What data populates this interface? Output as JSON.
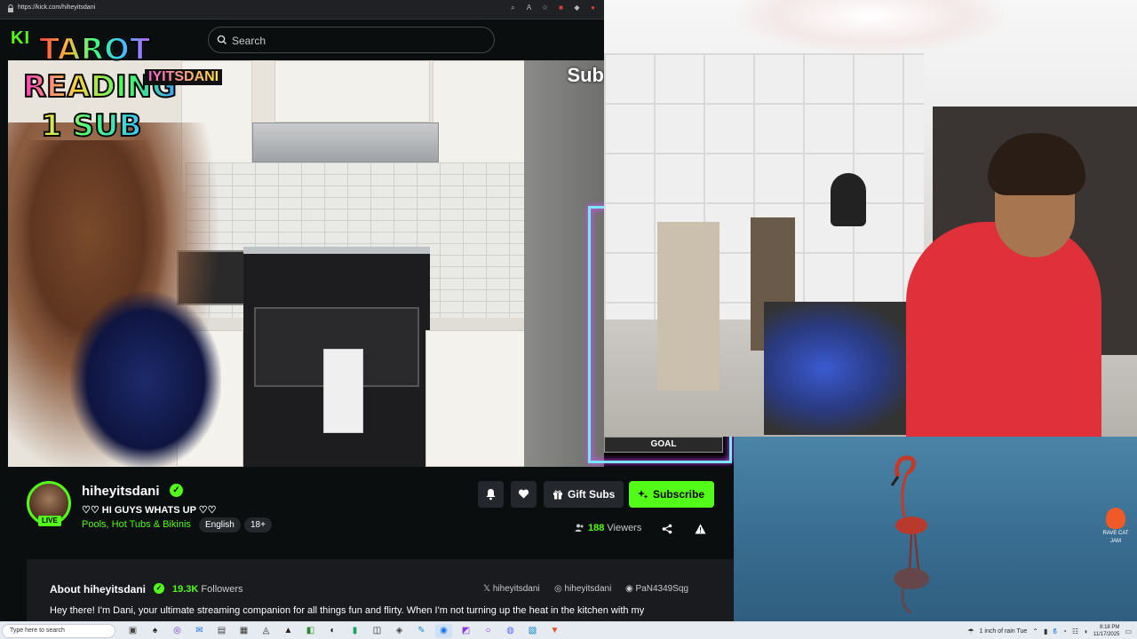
{
  "browser": {
    "url": "https://kick.com/hiheyitsdani"
  },
  "kick": {
    "logo_text": "KI",
    "search_placeholder": "Search"
  },
  "overlay": {
    "tarot_line1": "TAROT",
    "tarot_line2": "READING",
    "tarot_line3": "1 SUB",
    "handle": "IYITSDANI",
    "sub_text": "Sub",
    "goal_label": "GOAL"
  },
  "channel": {
    "name": "hiheyitsdani",
    "live_label": "LIVE",
    "stream_title": "♡♡ HI GUYS WHATS UP ♡♡",
    "category": "Pools, Hot Tubs & Bikinis",
    "tags": [
      "English",
      "18+"
    ],
    "gift_label": "Gift Subs",
    "subscribe_label": "Subscribe",
    "viewers_count": "188",
    "viewers_label": "Viewers"
  },
  "about": {
    "heading": "About hiheyitsdani",
    "followers_count": "19.3K",
    "followers_label": "Followers",
    "socials": [
      {
        "icon": "x-icon",
        "label": "hiheyitsdani"
      },
      {
        "icon": "instagram-icon",
        "label": "hiheyitsdani"
      },
      {
        "icon": "discord-icon",
        "label": "PaN4349Sqg"
      }
    ],
    "description": "Hey there! I'm Dani, your ultimate streaming companion for all things fun and flirty. When I'm not turning up the heat in the kitchen with my"
  },
  "desktop": {
    "rave_label_1": "RAVE CAT",
    "rave_label_2": "JAM"
  },
  "taskbar": {
    "search_placeholder": "Type here to search",
    "weather": "1 inch of rain Tue",
    "time": "8:18 PM",
    "date": "11/17/2025"
  },
  "colors": {
    "kick_green": "#53fc18",
    "panel_bg": "#0b0e0f",
    "card_bg": "#191b1f"
  }
}
